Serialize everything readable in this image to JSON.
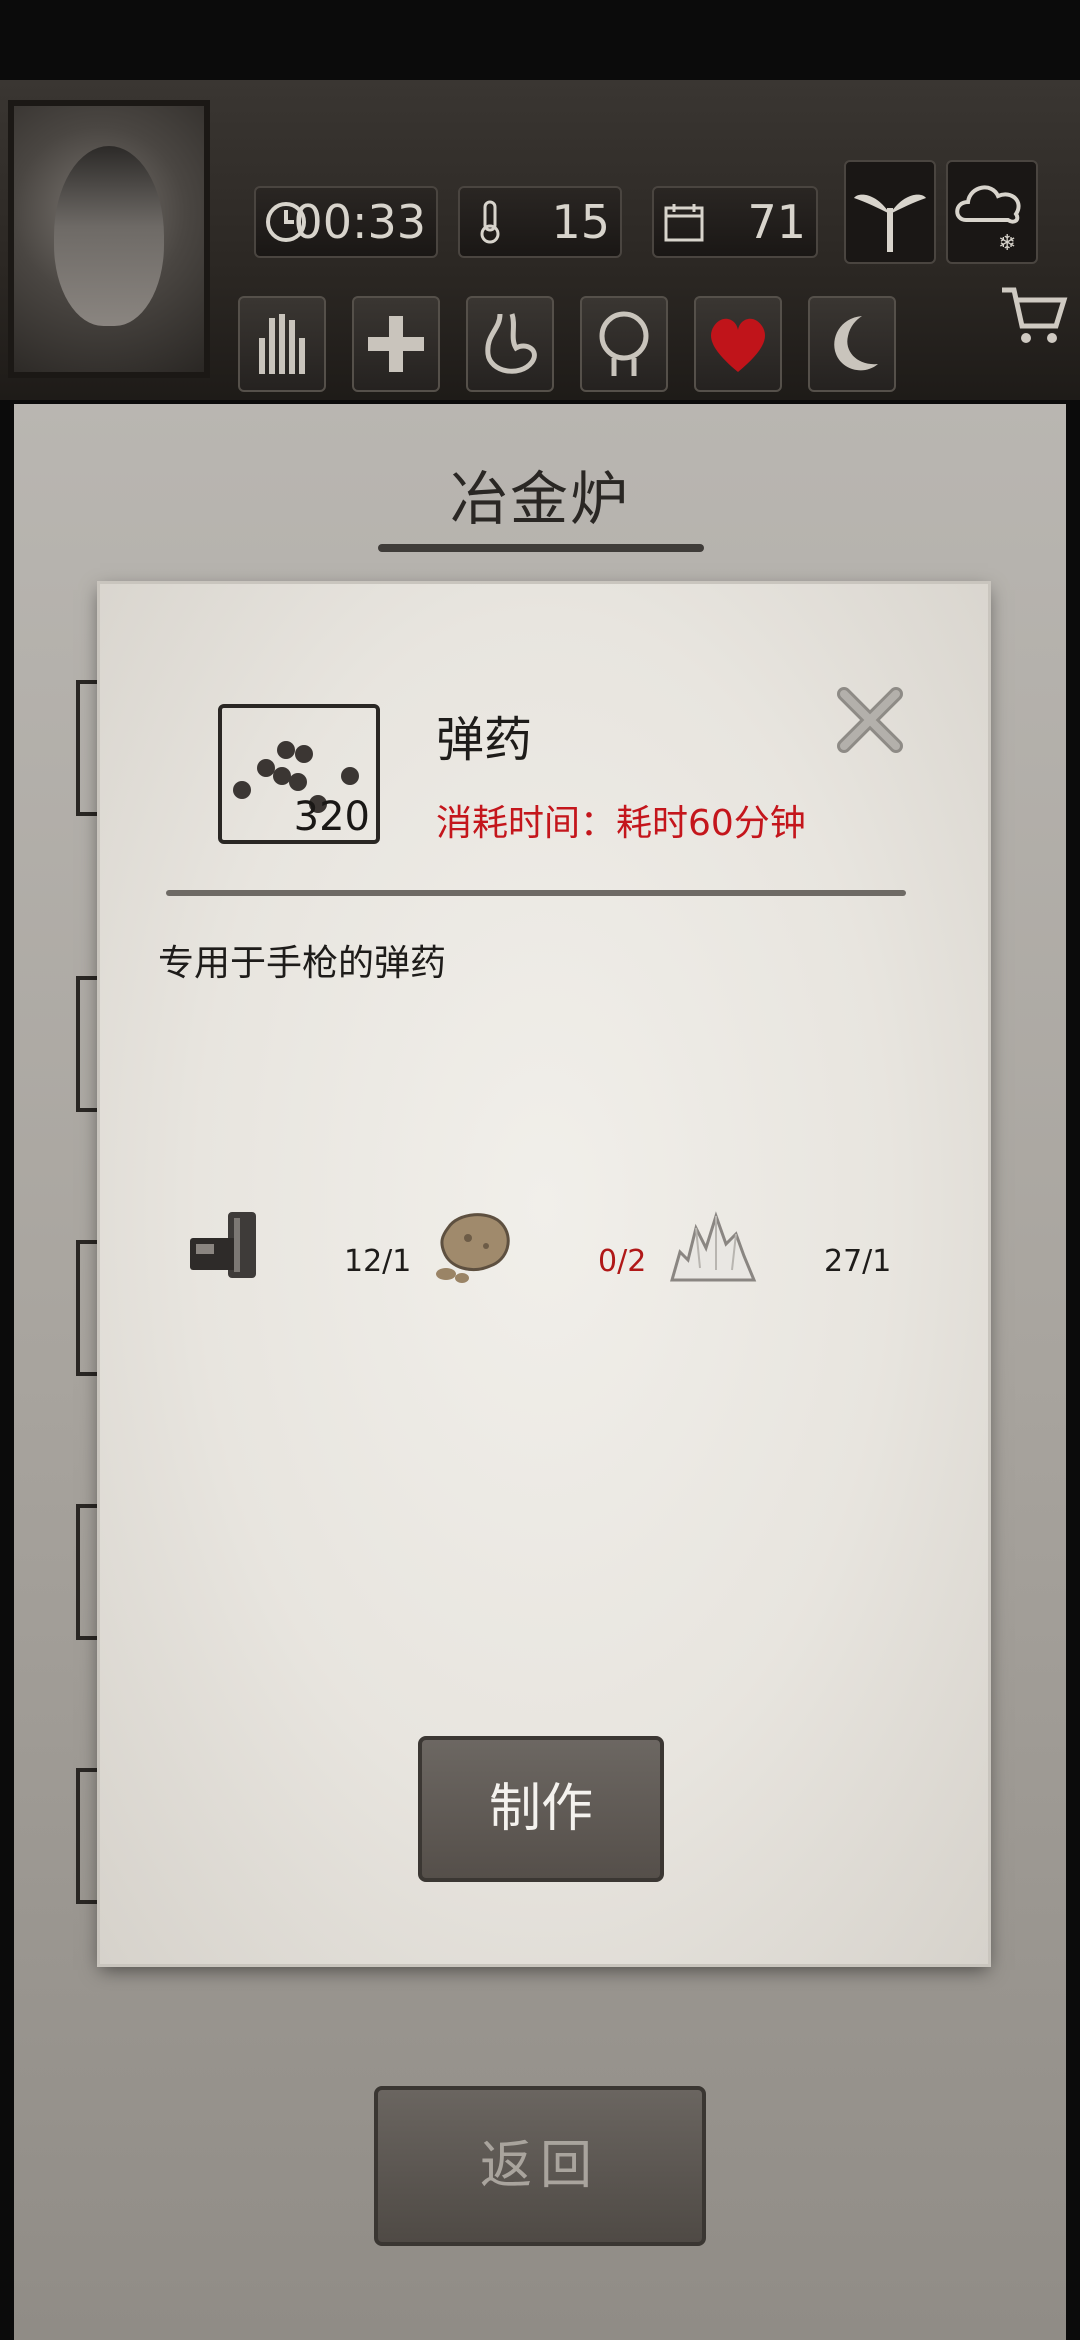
{
  "status": {
    "clock": "00:33",
    "temperature": "15",
    "day": "71",
    "icons": [
      "clock-icon",
      "thermometer-icon",
      "calendar-icon"
    ]
  },
  "weather": [
    "sprout-icon",
    "snow-cloud-icon"
  ],
  "status_buttons": [
    "hand-icon",
    "plus-icon",
    "stomach-icon",
    "brain-icon",
    "heart-icon",
    "moon-icon"
  ],
  "panel": {
    "title": "冶金炉",
    "back_label": "返回"
  },
  "dialog": {
    "item_name": "弹药",
    "item_count": "320",
    "time_label": "消耗时间：耗时60分钟",
    "description": "专用于手枪的弹药",
    "materials": [
      {
        "icon": "metal-bars-icon",
        "qty": "12/1",
        "sufficient": true
      },
      {
        "icon": "ore-rock-icon",
        "qty": "0/2",
        "sufficient": false
      },
      {
        "icon": "salt-crystal-icon",
        "qty": "27/1",
        "sufficient": true
      }
    ],
    "make_label": "制作"
  },
  "colors": {
    "time_text": "#c4161c",
    "shortage": "#b01818",
    "heart": "#c0141a"
  }
}
